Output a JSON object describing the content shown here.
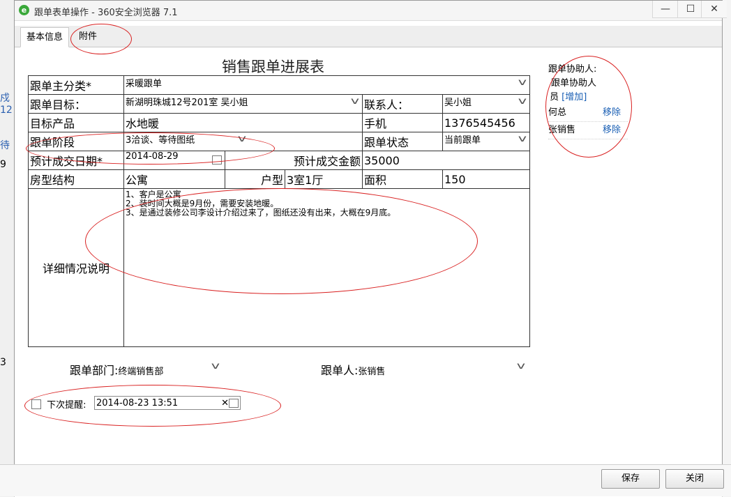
{
  "background": {
    "fragments": [
      "戍12",
      "待",
      "9",
      "3"
    ]
  },
  "window": {
    "title": "跟单表单操作 - 360安全浏览器 7.1",
    "controls": [
      "—",
      "☐",
      "✕"
    ]
  },
  "tabs": [
    "基本信息",
    "附件"
  ],
  "form": {
    "title": "销售跟单进展表",
    "main_category_label": "跟单主分类*",
    "main_category_value": "采暖跟单",
    "target_label": "跟单目标：",
    "target_value": "新湖明珠城12号201室 吴小姐",
    "contact_label": "联系人：",
    "contact_value": "吴小姐",
    "product_label": "目标产品",
    "product_value": "水地暖",
    "phone_label": "手机",
    "phone_value": "1376545456",
    "stage_label": "跟单阶段",
    "stage_value": "3洽谈、等待图纸",
    "status_label": "跟单状态",
    "status_value": "当前跟单",
    "close_date_label": "预计成交日期*",
    "close_date_value": "2014-08-29",
    "amount_label": "预计成交金额",
    "amount_value": "35000",
    "structure_label": "房型结构",
    "structure_value": "公寓",
    "layout_label": "户型",
    "layout_value": "3室1厅",
    "area_label": "面积",
    "area_value": "150",
    "detail_label": "详细情况说明",
    "detail_lines": [
      "1、客户是公寓",
      "2、装时间大概是9月份，需要安装地暖。",
      "3、是通过装修公司李设计介绍过来了，图纸还没有出来，大概在9月底。"
    ],
    "dept_label": "跟单部门:",
    "dept_value": "终端销售部",
    "person_label": "跟单人:",
    "person_value": "张销售"
  },
  "assistants": {
    "heading": "跟单协助人:",
    "sub_label_line1": "跟单协助人",
    "sub_label_line2": "员",
    "add_link": "[增加]",
    "people": [
      {
        "name": "何总",
        "action": "移除"
      },
      {
        "name": "张销售",
        "action": "移除"
      }
    ]
  },
  "reminder": {
    "label": "下次提醒:",
    "value": "2014-08-23 13:51"
  },
  "buttons": {
    "save": "保存",
    "close": "关闭"
  },
  "annotation_color": "#d92020"
}
